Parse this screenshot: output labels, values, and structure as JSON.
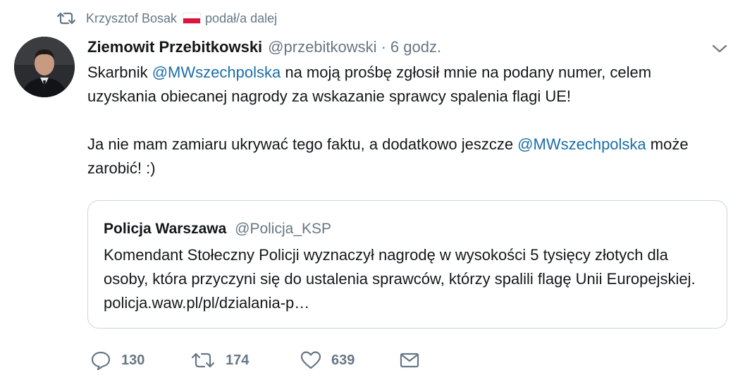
{
  "retweet_context": {
    "user": "Krzysztof Bosak",
    "action": "podał/a dalej"
  },
  "tweet": {
    "author_name": "Ziemowit Przebitkowski",
    "author_handle": "@przebitkowski",
    "separator": "·",
    "time": "6 godz.",
    "paragraph1": {
      "prefix": "Skarbnik ",
      "mention": "@MWszechpolska",
      "suffix": " na moją prośbę zgłosił mnie na podany numer, celem uzyskania obiecanej nagrody za wskazanie sprawcy spalenia flagi UE!"
    },
    "paragraph2": {
      "prefix": "Ja nie mam zamiaru ukrywać tego faktu, a dodatkowo jeszcze ",
      "mention": "@MWszechpolska",
      "suffix": " może zarobić! :)"
    }
  },
  "quoted_tweet": {
    "author_name": "Policja Warszawa",
    "author_handle": "@Policja_KSP",
    "text": "Komendant Stołeczny Policji wyznaczył nagrodę w wysokości 5 tysięcy złotych dla osoby, która przyczyni się do ustalenia sprawców, którzy spalili flagę Unii Europejskiej. policja.waw.pl/pl/dzialania-p…"
  },
  "actions": {
    "replies": "130",
    "retweets": "174",
    "likes": "639"
  },
  "icons": {
    "retweet_context": "retweet-icon",
    "flag": "poland-flag-icon",
    "caret": "chevron-down-icon",
    "reply": "reply-icon",
    "retweet": "retweet-icon",
    "like": "heart-icon",
    "dm": "envelope-icon"
  },
  "colors": {
    "text": "#14171a",
    "secondary": "#657786",
    "mention": "#1b6ea8",
    "border": "#ccd6dd",
    "flag_red": "#dc143c"
  }
}
